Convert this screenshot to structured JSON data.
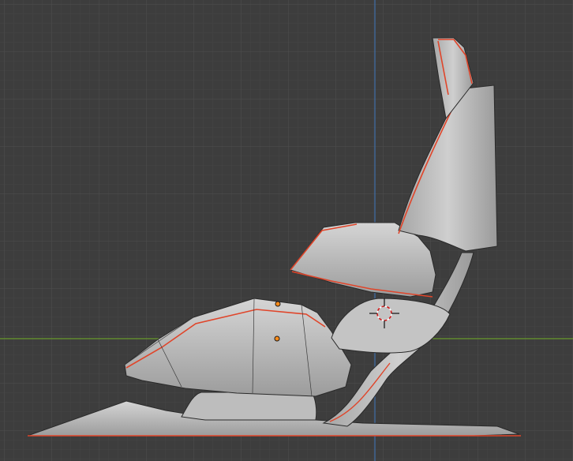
{
  "viewport": {
    "view": "orthographic-side",
    "grid": true,
    "background": "#3d3d3d",
    "grid_colors": {
      "minor": "#444444",
      "major": "#4c4c4c"
    },
    "axis_colors": {
      "vertical": "#3f6fa8",
      "horizontal": "#6a9a2c"
    },
    "selection_color": "#e0452a",
    "wire_color": "#2a2a2a",
    "origin_color": "#ff8c1a"
  },
  "scene": {
    "object": "chair",
    "mode": "edit-wireframe-overlay",
    "cursor": "3d-cursor-icon",
    "origins": 2
  }
}
